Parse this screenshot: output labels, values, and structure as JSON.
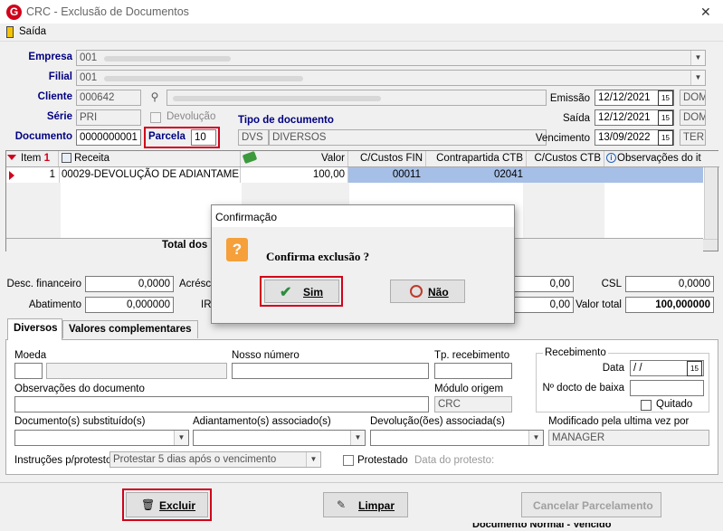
{
  "window": {
    "title": "CRC - Exclusão de Documentos",
    "close": "✕",
    "menu_exit": "Saída"
  },
  "form": {
    "empresa_label": "Empresa",
    "empresa_code": "001",
    "filial_label": "Filial",
    "filial_code": "001",
    "cliente_label": "Cliente",
    "cliente_code": "000642",
    "serie_label": "Série",
    "serie_value": "PRI",
    "devolucao_label": "Devolução",
    "documento_label": "Documento",
    "documento_value": "0000000001",
    "parcela_label": "Parcela",
    "parcela_value": "10",
    "tipo_label": "Tipo de documento",
    "tipo_code": "DVS",
    "tipo_desc": "DIVERSOS",
    "emissao_label": "Emissão",
    "emissao_value": "12/12/2021",
    "emissao_day": "DOM",
    "saida_label": "Saída",
    "saida_value": "12/12/2021",
    "saida_day": "DOM",
    "vencimento_label": "Vencimento",
    "vencimento_value": "13/09/2022",
    "vencimento_day": "TER"
  },
  "grid": {
    "columns": [
      "Item",
      "Receita",
      "Valor",
      "C/Custos FIN",
      "Contrapartida CTB",
      "C/Custos CTB",
      "Observações do it"
    ],
    "row": {
      "item": "1",
      "receita": "00029-DEVOLUÇÃO DE ADIANTAME...",
      "valor": "100,00",
      "ccfin": "00011",
      "contrapartida": "02041"
    },
    "total_label": "Total dos"
  },
  "totals": {
    "desc_fin_label": "Desc. financeiro",
    "desc_fin_value": "0,0000",
    "acresc_label": "Acrésc",
    "abatimento_label": "Abatimento",
    "abatimento_value": "0,000000",
    "ir_label": "IR",
    "field1_value": "0,00",
    "field2_value": "0,00",
    "csl_label": "CSL",
    "csl_value": "0,0000",
    "valor_total_label": "Valor total",
    "valor_total_value": "100,000000"
  },
  "tabs": {
    "diversos": "Diversos",
    "complementares": "Valores complementares"
  },
  "diversos": {
    "moeda_label": "Moeda",
    "nosso_numero_label": "Nosso número",
    "tp_recebimento_label": "Tp. recebimento",
    "recebimento_group": "Recebimento",
    "data_label": "Data",
    "data_value": " /  /",
    "ndocto_label": "Nº docto de baixa",
    "quitado_label": "Quitado",
    "obs_label": "Observações do documento",
    "modulo_label": "Módulo origem",
    "modulo_value": "CRC",
    "doc_subst_label": "Documento(s) substituído(s)",
    "adiant_label": "Adiantamento(s) associado(s)",
    "devol_label": "Devolução(ões) associada(s)",
    "modificado_label": "Modificado pela ultima vez por",
    "modificado_value": "MANAGER",
    "instrucoes_label": "Instruções p/protesto",
    "instrucoes_value": "Protestar 5 dias após o vencimento",
    "protestado_label": "Protestado",
    "data_protesto_label": "Data do protesto:"
  },
  "buttons": {
    "excluir": "Excluir",
    "limpar": "Limpar",
    "cancelar": "Cancelar Parcelamento"
  },
  "dialog": {
    "title": "Confirmação",
    "message": "Confirma exclusão ?",
    "yes": "Sim",
    "no": "Não"
  },
  "background": {
    "text": "Documento Normal - Vencido"
  },
  "colors": {
    "highlight_red": "#d0021b",
    "label_navy": "#000080",
    "selected_row": "#a6bfe6"
  }
}
